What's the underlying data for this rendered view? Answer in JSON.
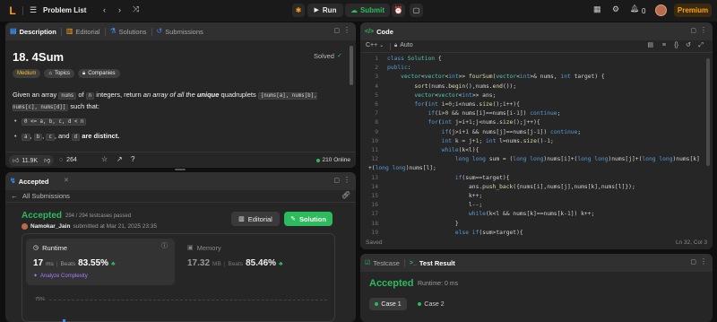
{
  "topbar": {
    "logo": "L",
    "problem_list": "Problem List",
    "run": "Run",
    "submit": "Submit",
    "streak": "0",
    "premium": "Premium"
  },
  "description_panel": {
    "tabs": [
      "Description",
      "Editorial",
      "Solutions",
      "Submissions"
    ],
    "title": "18. 4Sum",
    "status": "Solved",
    "difficulty": "Medium",
    "topics": "Topics",
    "companies": "Companies",
    "intro_1": "Given an array ",
    "code_nums": "nums",
    "intro_2": " of ",
    "code_n": "n",
    "intro_3": " integers, return ",
    "intro_4": "an array of all the ",
    "intro_unique": "unique",
    "intro_5": " quadruplets ",
    "code_quad": "[nums[a], nums[b], nums[c], nums[d]]",
    "intro_6": " such that:",
    "bullet_1": "0 <= a, b, c, d < n",
    "bullet_2_a": "a",
    "bullet_2_b": "b",
    "bullet_2_c": "c",
    "bullet_2_and": ", and ",
    "bullet_2_d": "d",
    "bullet_2_end": " are distinct.",
    "likes": "11.9K",
    "comments": "264",
    "online": "210 Online"
  },
  "accepted_panel": {
    "tab": "Accepted",
    "back": "All Submissions",
    "status": "Accepted",
    "testcases": "294 / 294 testcases passed",
    "user": "Namokar_Jain",
    "submitted": "submitted at Mar 21, 2025 23:35",
    "editorial_btn": "Editorial",
    "solution_btn": "Solution",
    "runtime_label": "Runtime",
    "runtime_value": "17",
    "runtime_unit": "ms",
    "beats_label": "Beats",
    "runtime_beats": "83.55%",
    "analyze": "Analyze Complexity",
    "memory_label": "Memory",
    "memory_value": "17.32",
    "memory_unit": "MB",
    "memory_beats": "85.46%",
    "chart_tick": "75%"
  },
  "code_panel": {
    "tab": "Code",
    "language": "C++",
    "mode": "Auto",
    "saved": "Saved",
    "cursor": "Ln 32, Col 3",
    "line_numbers": [
      "1",
      "2",
      "3",
      "4",
      "5",
      "6",
      "7",
      "8",
      "9",
      "10",
      "11",
      "12",
      "",
      "13",
      "14",
      "15",
      "16",
      "17",
      "18",
      "19"
    ]
  },
  "result_panel": {
    "tab_testcase": "Testcase",
    "tab_result": "Test Result",
    "status": "Accepted",
    "runtime": "Runtime: 0 ms",
    "case1": "Case 1",
    "case2": "Case 2"
  },
  "colors": {
    "accent_green": "#2cbb5d",
    "accent_orange": "#ffa116",
    "easy_teal": "#00b8a3",
    "medium_yellow": "#ffc01e"
  }
}
